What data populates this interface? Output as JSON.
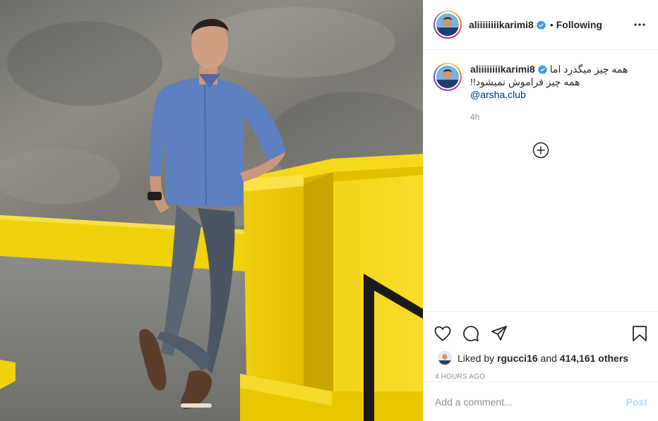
{
  "post": {
    "username": "aliiiiiiiikarimi8",
    "follow_status": "Following",
    "separator": "•",
    "caption_line1": "همه چیز میگذرد اما",
    "caption_line2": "!!همه چیز فراموش نمیشود",
    "mention": "@arsha.club",
    "caption_age": "4h",
    "likes_prefix": "Liked by",
    "liked_by_user": "rgucci16",
    "likes_and": "and",
    "likes_count": "414,161 others",
    "post_time": "4 HOURS AGO"
  },
  "comment": {
    "placeholder": "Add a comment...",
    "post_label": "Post"
  },
  "icons": {
    "verified": "verified-badge-icon",
    "more": "more-options-icon",
    "add": "plus-circle-icon",
    "like": "heart-icon",
    "comment": "comment-icon",
    "share": "paper-plane-icon",
    "save": "bookmark-icon"
  },
  "colors": {
    "verified_blue": "#3897f0",
    "mention_blue": "#00376b",
    "post_button_disabled": "#b2dffc",
    "muted_text": "#8e8e8e",
    "wall_yellow": "#f2d600"
  }
}
